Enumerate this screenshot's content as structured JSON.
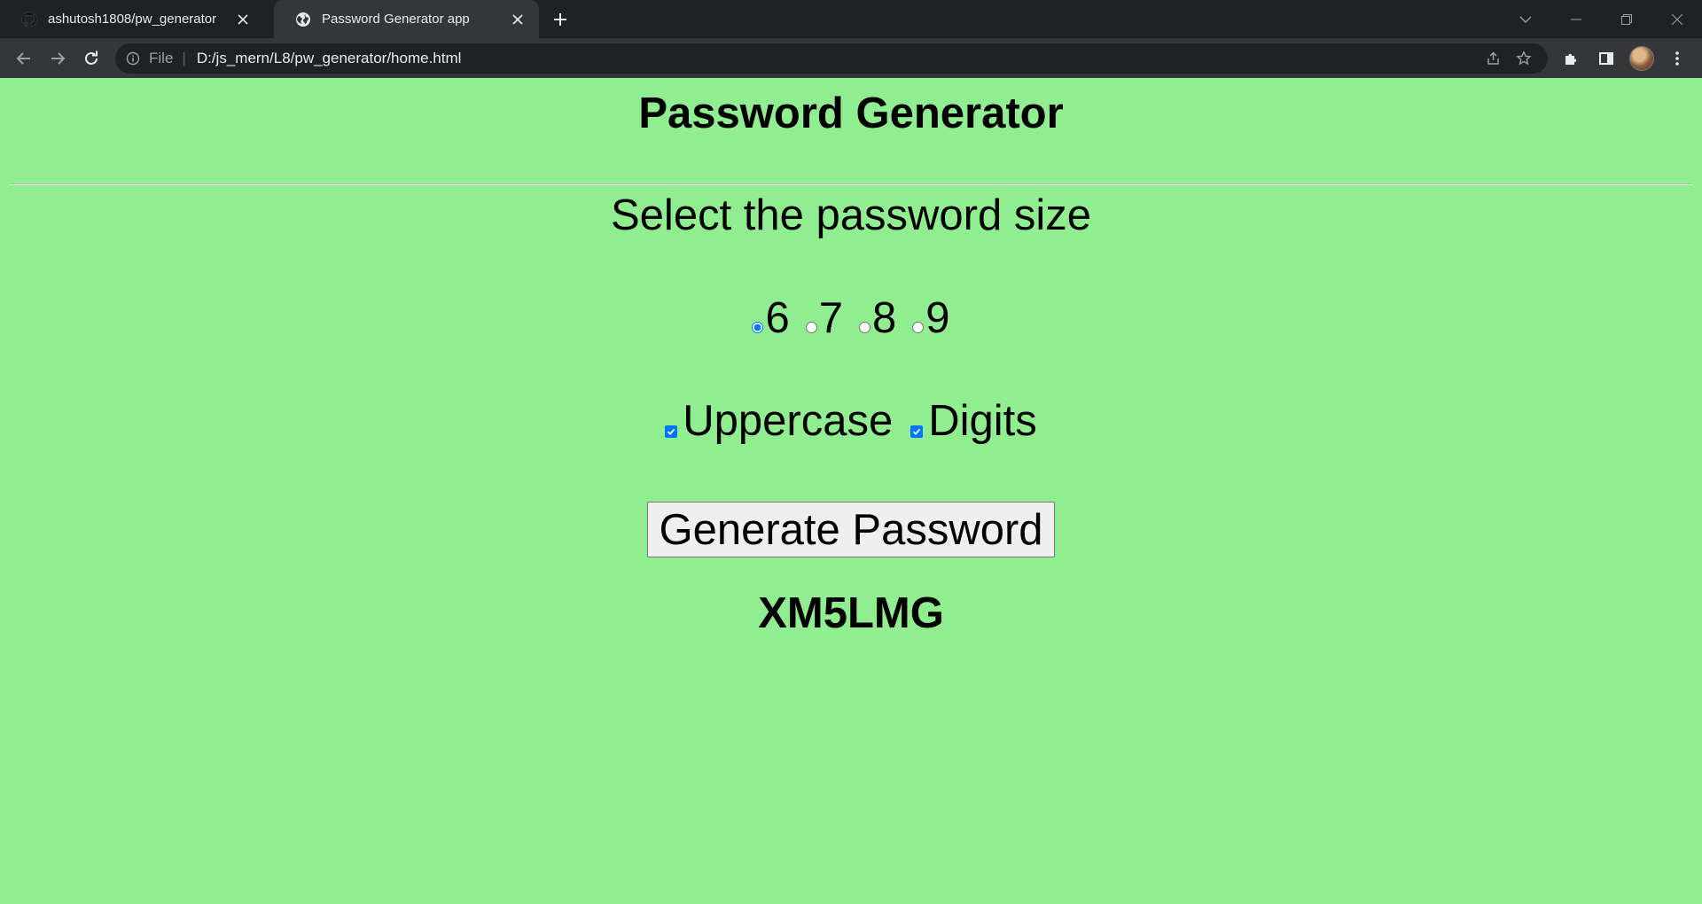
{
  "browser": {
    "tabs": [
      {
        "title": "ashutosh1808/pw_generator",
        "active": false,
        "icon": "github-icon"
      },
      {
        "title": "Password Generator app",
        "active": true,
        "icon": "globe-icon"
      }
    ],
    "address": {
      "scheme": "File",
      "url": "D:/js_mern/L8/pw_generator/home.html"
    }
  },
  "page": {
    "heading": "Password Generator",
    "size_label": "Select the password size",
    "size_options": [
      {
        "label": "6",
        "checked": true
      },
      {
        "label": "7",
        "checked": false
      },
      {
        "label": "8",
        "checked": false
      },
      {
        "label": "9",
        "checked": false
      }
    ],
    "checkboxes": [
      {
        "label": "Uppercase",
        "checked": true
      },
      {
        "label": "Digits",
        "checked": true
      }
    ],
    "generate_button": "Generate Password",
    "password": "XM5LMG",
    "colors": {
      "page_background": "#90ee90",
      "accent": "#0075ff"
    }
  }
}
